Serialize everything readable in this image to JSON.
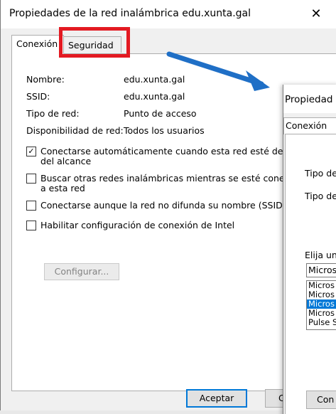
{
  "window": {
    "title": "Propiedades de la red inalámbrica edu.xunta.gal",
    "close_glyph": "✕"
  },
  "tabs": [
    {
      "label": "Conexión",
      "active": true
    },
    {
      "label": "Seguridad",
      "active": false
    }
  ],
  "properties": [
    {
      "label": "Nombre:",
      "value": "edu.xunta.gal"
    },
    {
      "label": "SSID:",
      "value": "edu.xunta.gal"
    },
    {
      "label": "Tipo de red:",
      "value": "Punto de acceso"
    },
    {
      "label": "Disponibilidad de red:",
      "value": "Todos los usuarios"
    }
  ],
  "checkboxes": [
    {
      "line1": "Conectarse automáticamente cuando esta red esté dentr",
      "line2": "del alcance",
      "checked": true
    },
    {
      "line1": "Buscar otras redes inalámbricas mientras se esté conecta",
      "line2": "a esta red",
      "checked": false
    },
    {
      "line1": "Conectarse aunque la red no difunda su nombre (SSID)",
      "line2": "",
      "checked": false
    },
    {
      "line1": "Habilitar configuración de conexión de Intel",
      "line2": "",
      "checked": false
    }
  ],
  "buttons": {
    "configure": "Configurar...",
    "accept": "Aceptar",
    "cancel_partial": "C"
  },
  "second_dialog": {
    "title": "Propiedad",
    "tab": "Conexión",
    "labels": [
      "Tipo de",
      "Tipo de",
      "Elija un"
    ],
    "combo_value": "Micros",
    "list_options": [
      "Micros",
      "Micros",
      "Micros",
      "Micros",
      "Pulse S"
    ],
    "selected_index": 2,
    "button": "Con"
  },
  "colors": {
    "highlight_box": "#e31a22",
    "arrow": "#1f6fc6",
    "selection": "#0078d7"
  }
}
